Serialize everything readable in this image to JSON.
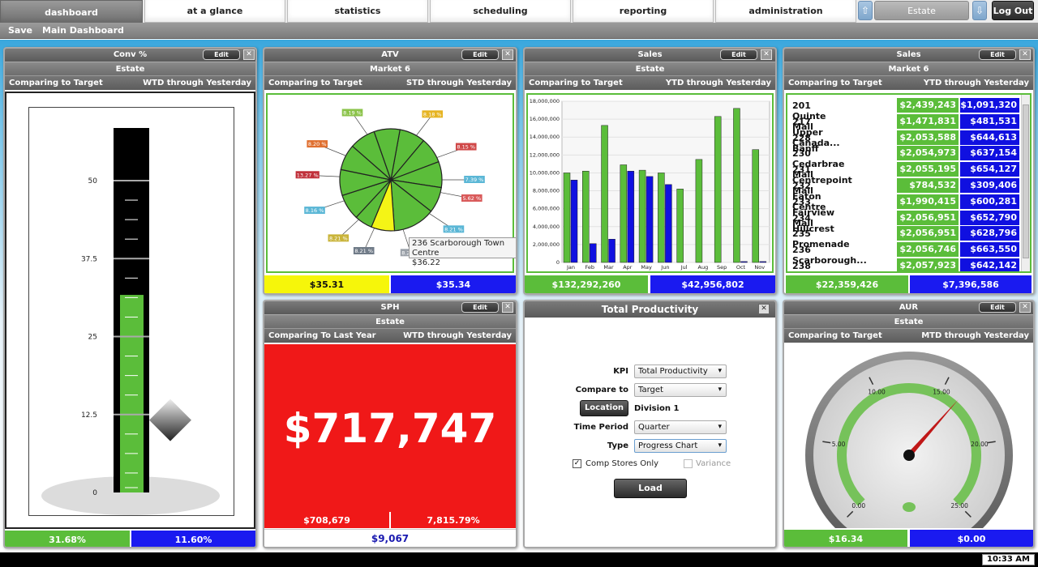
{
  "nav": {
    "tabs": [
      "dashboard",
      "at a glance",
      "statistics",
      "scheduling",
      "reporting",
      "administration"
    ],
    "up_arrow": "⇧",
    "down_arrow": "⇩",
    "location": "Estate",
    "logout": "Log Out"
  },
  "subnav": {
    "save": "Save",
    "main_dashboard": "Main Dashboard"
  },
  "edit_label": "Edit",
  "close_label": "✕",
  "conv": {
    "title": "Conv %",
    "sub": "Estate",
    "compare": "Comparing to Target",
    "period": "WTD through Yesterday",
    "ticks": [
      "50",
      "37.5",
      "25",
      "12.5",
      "0"
    ],
    "value_fraction": 0.6336,
    "target_fraction": 0.232,
    "actual": "31.68%",
    "target": "11.60%"
  },
  "atv": {
    "title": "ATV",
    "sub": "Market 6",
    "compare": "Comparing to Target",
    "period": "STD through Yesterday",
    "pie_labels": [
      "8.19 %",
      "8.18 %",
      "8.20 %",
      "8.15 %",
      "13.27 %",
      "7.39 %",
      "5.62 %",
      "8.16 %",
      "8.21 %",
      "8.21 %",
      "8.21 %",
      "8.20 %"
    ],
    "tooltip_name": "236 Scarborough Town Centre",
    "tooltip_value": "$36.22",
    "actual": "$35.31",
    "target": "$35.34"
  },
  "sales_estate": {
    "title": "Sales",
    "sub": "Estate",
    "compare": "Comparing to Target",
    "period": "YTD through Yesterday",
    "actual": "$132,292,260",
    "target": "$42,956,802"
  },
  "chart_data": {
    "type": "bar",
    "categories": [
      "Jan",
      "Feb",
      "Mar",
      "Apr",
      "May",
      "Jun",
      "Jul",
      "Aug",
      "Sep",
      "Oct",
      "Nov"
    ],
    "series": [
      {
        "values": [
          10000000,
          10200000,
          15300000,
          10900000,
          10300000,
          10000000,
          8200000,
          11500000,
          16300000,
          17200000,
          12600000
        ]
      },
      {
        "values": [
          9200000,
          2100000,
          2600000,
          10200000,
          9600000,
          8700000,
          0,
          0,
          0,
          100000,
          100000
        ]
      }
    ],
    "ylim": [
      0,
      18000000
    ],
    "yticks": [
      "0",
      "2,000,000",
      "4,000,000",
      "6,000,000",
      "8,000,000",
      "10,000,000",
      "12,000,000",
      "14,000,000",
      "16,000,000",
      "18,000,000"
    ],
    "colors": [
      "#5bbd3a",
      "#1010e0"
    ]
  },
  "sales_market": {
    "title": "Sales",
    "sub": "Market 6",
    "compare": "Comparing to Target",
    "period": "YTD through Yesterday",
    "rows": [
      {
        "name": "201 Quinte Mall",
        "actual": "$2,439,243",
        "target": "$1,091,320"
      },
      {
        "name": "217 Upper Canada...",
        "actual": "$1,471,831",
        "target": "$481,531"
      },
      {
        "name": "228 Banff",
        "actual": "$2,053,588",
        "target": "$644,613"
      },
      {
        "name": "230 Cedarbrae Mall",
        "actual": "$2,054,973",
        "target": "$637,154"
      },
      {
        "name": "231 Centrepoint Mall",
        "actual": "$2,055,195",
        "target": "$654,127"
      },
      {
        "name": "232 Eaton Centre",
        "actual": "$784,532",
        "target": "$309,406"
      },
      {
        "name": "233 Fairview Mall",
        "actual": "$1,990,415",
        "target": "$600,281"
      },
      {
        "name": "234 Hillcrest",
        "actual": "$2,056,951",
        "target": "$652,790"
      },
      {
        "name": "235 Promenade",
        "actual": "$2,056,951",
        "target": "$628,796"
      },
      {
        "name": "236 Scarborough...",
        "actual": "$2,056,746",
        "target": "$663,550"
      },
      {
        "name": "238 Woodbine Centre",
        "actual": "$2,057,923",
        "target": "$642,142"
      }
    ],
    "actual": "$22,359,426",
    "target": "$7,396,586"
  },
  "sph": {
    "title": "SPH",
    "sub": "Estate",
    "compare": "Comparing To Last Year",
    "period": "WTD through Yesterday",
    "big": "$717,747",
    "last_year": "$708,679",
    "pct": "7,815.79%",
    "diff": "$9,067"
  },
  "productivity": {
    "title": "Total Productivity",
    "kpi_label": "KPI",
    "kpi_value": "Total Productivity",
    "compare_label": "Compare to",
    "compare_value": "Target",
    "location_button": "Location",
    "location_value": "Division 1",
    "period_label": "Time Period",
    "period_value": "Quarter",
    "type_label": "Type",
    "type_value": "Progress Chart",
    "comp_stores": "Comp Stores Only",
    "variance": "Variance",
    "load": "Load"
  },
  "aur": {
    "title": "AUR",
    "sub": "Estate",
    "compare": "Comparing to Target",
    "period": "MTD through Yesterday",
    "gauge_labels": [
      "0.00",
      "5.00",
      "10.00",
      "15.00",
      "20.00",
      "25.00"
    ],
    "needle_value": 16.34,
    "gauge_max": 25,
    "actual": "$16.34",
    "target": "$0.00"
  },
  "clock": "10:33 AM"
}
